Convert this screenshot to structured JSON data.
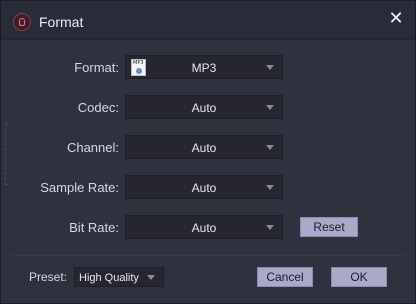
{
  "window": {
    "title": "Format",
    "close_label": "✕"
  },
  "form": {
    "format": {
      "label": "Format:",
      "value": "MP3",
      "icon_tag": "MP3"
    },
    "codec": {
      "label": "Codec:",
      "value": "Auto"
    },
    "channel": {
      "label": "Channel:",
      "value": "Auto"
    },
    "sample_rate": {
      "label": "Sample Rate:",
      "value": "Auto"
    },
    "bit_rate": {
      "label": "Bit Rate:",
      "value": "Auto"
    },
    "reset_label": "Reset"
  },
  "footer": {
    "preset_label": "Preset:",
    "preset_value": "High Quality",
    "cancel_label": "Cancel",
    "ok_label": "OK"
  },
  "colors": {
    "accent_icon": "#ff6d86",
    "button_bg": "#a9a9c9",
    "background": "#30313f"
  },
  "icons": {
    "app": "app-logo-icon",
    "close": "close-icon",
    "format": "mp3-file-icon",
    "dropdown": "chevron-down-icon"
  }
}
